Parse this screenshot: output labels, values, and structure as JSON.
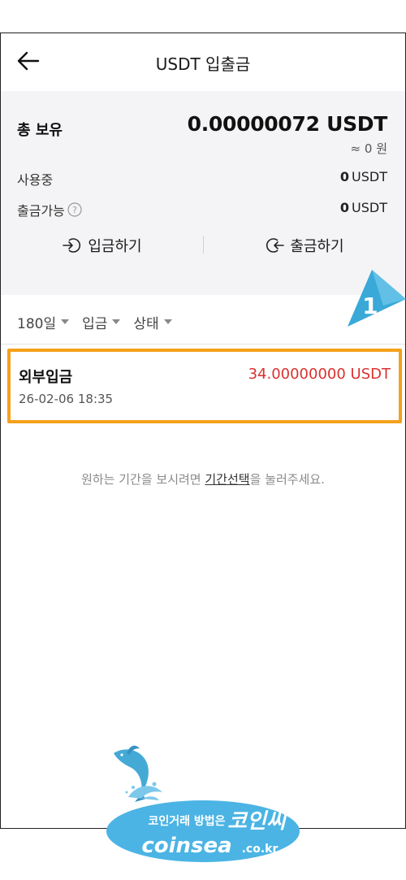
{
  "header": {
    "title": "USDT 입출금"
  },
  "summary": {
    "total_label": "총 보유",
    "total_value": "0.00000072 USDT",
    "krw_value": "≈ 0 원",
    "in_use_label": "사용중",
    "in_use_amount": "0",
    "in_use_unit": "USDT",
    "withdrawable_label": "출금가능",
    "withdrawable_amount": "0",
    "withdrawable_unit": "USDT"
  },
  "actions": {
    "deposit_label": "입금하기",
    "withdraw_label": "출금하기"
  },
  "filters": {
    "period": "180일",
    "type": "입금",
    "status": "상태"
  },
  "transactions": [
    {
      "type": "외부입금",
      "amount": "34.00000000 USDT",
      "date": "26-02-06 18:35"
    }
  ],
  "annotation": {
    "badge_number": "1"
  },
  "hint": {
    "before": "원하는 기간을 보시려면 ",
    "link": "기간선택",
    "after": "을 눌러주세요."
  },
  "watermark": {
    "line1": "코인거래 방법은",
    "brand_kr": "코인씨",
    "brand_en": "coinsea",
    "domain": ".co.kr"
  },
  "colors": {
    "accent_border": "#f5a11c",
    "amount_red": "#d8322f",
    "badge_blue": "#3aa9d8",
    "summary_bg": "#f4f4f6"
  }
}
